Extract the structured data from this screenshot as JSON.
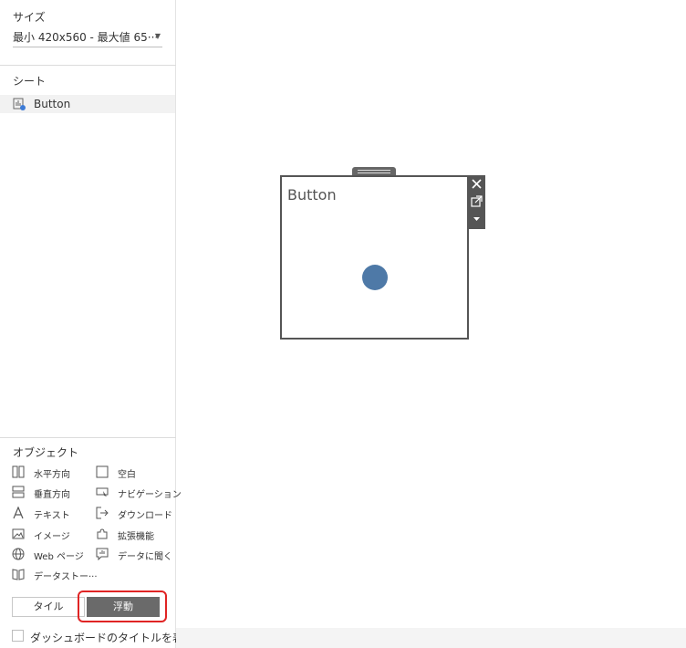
{
  "sidebar": {
    "size": {
      "title": "サイズ",
      "value": "最小 420x560 - 最大値 65···"
    },
    "sheets": {
      "title": "シート",
      "items": [
        {
          "label": "Button"
        }
      ]
    },
    "objects": {
      "title": "オブジェクト",
      "left": [
        "水平方向",
        "垂直方向",
        "テキスト",
        "イメージ",
        "Web ページ",
        "データストー···"
      ],
      "right": [
        "空白",
        "ナビゲーション",
        "ダウンロード",
        "拡張機能",
        "データに聞く"
      ]
    },
    "layout_mode": {
      "tile": "タイル",
      "float": "浮動",
      "selected": "浮動"
    },
    "show_title_checkbox": {
      "label": "ダッシュボードのタイトルを表示",
      "checked": false
    }
  },
  "canvas": {
    "worksheet": {
      "title": "Button",
      "mark_color": "#4e79a7"
    }
  },
  "colors": {
    "highlight": "#e02424",
    "float_button": "#6a6a6a",
    "mark": "#4e79a7"
  }
}
